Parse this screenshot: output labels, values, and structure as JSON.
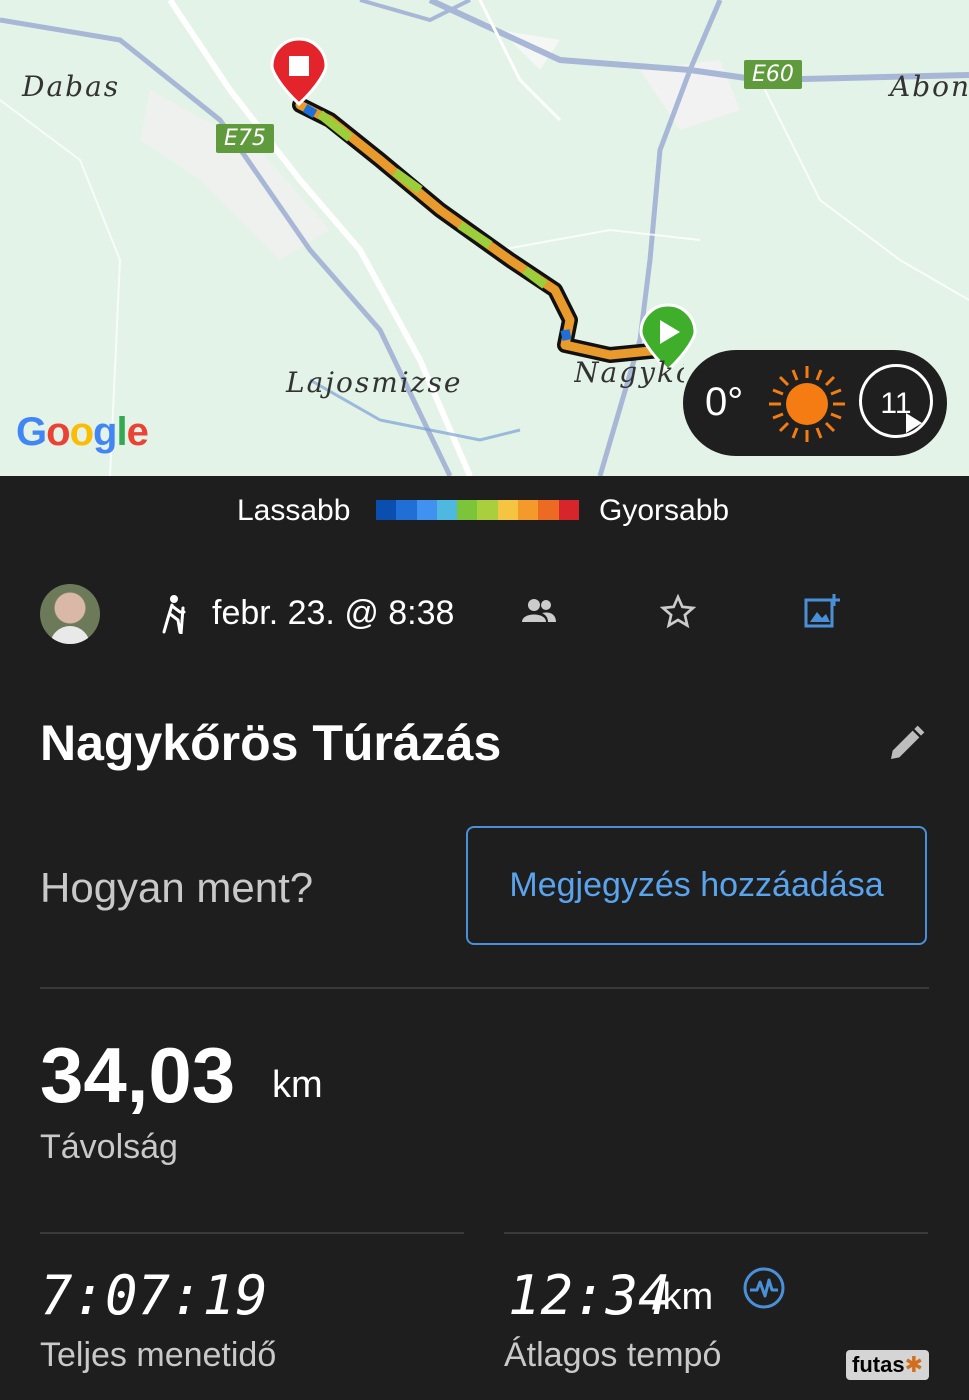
{
  "map": {
    "places": [
      "Dabas",
      "Abony",
      "Lajosmizse",
      "Nagykőrös"
    ],
    "roads": [
      "E75",
      "E60"
    ],
    "provider": "Google"
  },
  "weather": {
    "temperature": "0°",
    "wind_speed": "11"
  },
  "legend": {
    "slow_label": "Lassabb",
    "fast_label": "Gyorsabb",
    "colors": [
      "#0a4fb0",
      "#1f6fd6",
      "#3f92f0",
      "#4fb8e0",
      "#7cc43a",
      "#a9d03c",
      "#f5c542",
      "#f39a2b",
      "#ec6a21",
      "#d6262c"
    ]
  },
  "activity": {
    "type_icon": "hiking-icon",
    "date": "febr. 23. @ 8:38",
    "title": "Nagykőrös Túrázás"
  },
  "feedback": {
    "question": "Hogyan ment?",
    "add_note_label": "Megjegyzés hozzáadása"
  },
  "stats": {
    "distance": {
      "value": "34,03",
      "unit": "km",
      "label": "Távolság"
    },
    "total_time": {
      "value": "7:07:19",
      "label": "Teljes menetidő"
    },
    "avg_pace": {
      "value": "12:34",
      "unit": "/km",
      "label": "Átlagos tempó"
    }
  },
  "colors": {
    "background": "#1e1e1e",
    "accent": "#4a90d9",
    "start_marker": "#3fae2b",
    "end_marker": "#e3242b",
    "sun": "#f47c12"
  }
}
